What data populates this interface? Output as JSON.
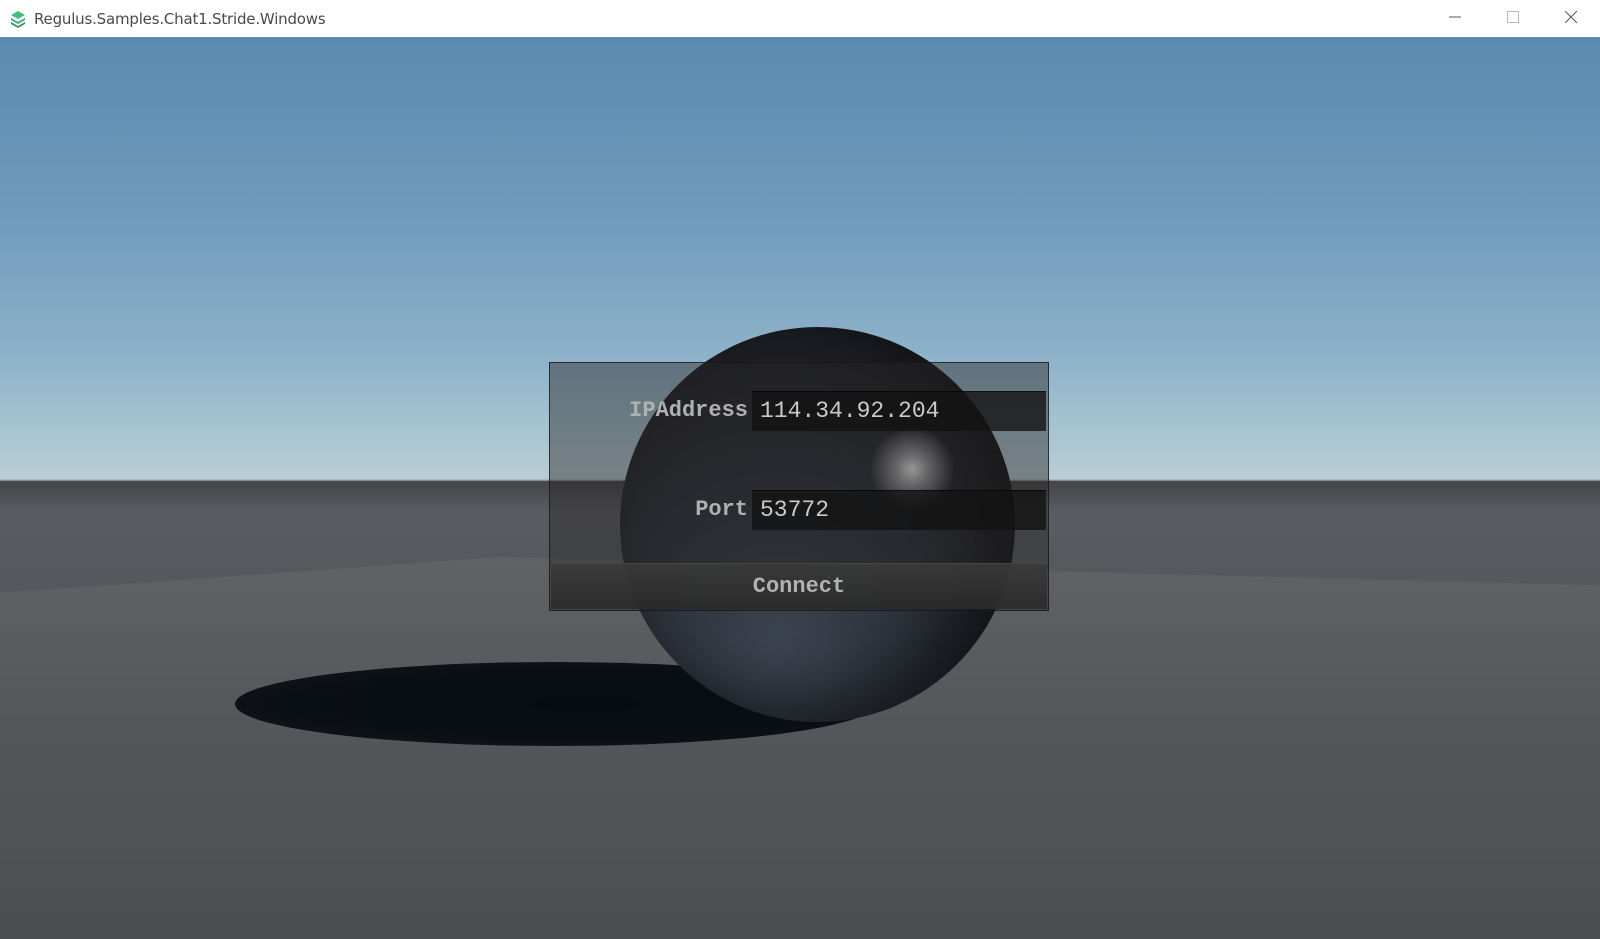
{
  "window": {
    "title": "Regulus.Samples.Chat1.Stride.Windows",
    "app_icon": "stride-layers-icon",
    "controls": {
      "minimize_icon": "minimize-icon",
      "maximize_icon": "maximize-icon",
      "close_icon": "close-icon"
    }
  },
  "connect_form": {
    "ip_label": "IPAddress",
    "ip_value": "114.34.92.204",
    "port_label": "Port",
    "port_value": "53772",
    "connect_label": "Connect"
  },
  "colors": {
    "app_icon": "#3fbf7f",
    "sky_top": "#5a8ab0",
    "ground": "#55585c",
    "panel_text": "#aeb0b1"
  }
}
